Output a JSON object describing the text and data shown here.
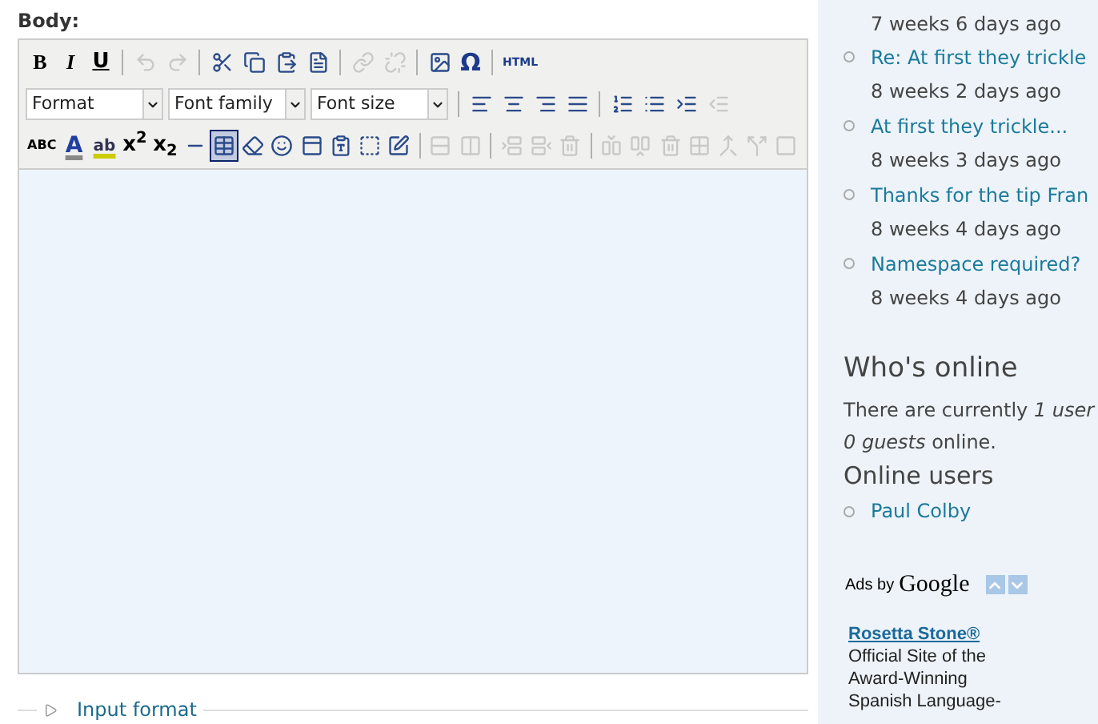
{
  "body_label": "Body:",
  "toolbar": [
    [
      {
        "kind": "text",
        "label": "B",
        "disabled": false
      },
      {
        "kind": "text",
        "label": "I",
        "disabled": false
      },
      {
        "kind": "text",
        "label": "U",
        "disabled": false
      },
      {
        "kind": "sep"
      },
      {
        "kind": "icon",
        "disabled": true
      },
      {
        "kind": "icon",
        "disabled": true
      },
      {
        "kind": "sep"
      },
      {
        "kind": "icon",
        "disabled": false
      },
      {
        "kind": "icon",
        "disabled": false
      },
      {
        "kind": "icon",
        "disabled": false
      },
      {
        "kind": "icon",
        "disabled": false
      },
      {
        "kind": "sep"
      },
      {
        "kind": "icon",
        "disabled": true
      },
      {
        "kind": "icon",
        "disabled": true
      },
      {
        "kind": "sep"
      },
      {
        "kind": "icon",
        "disabled": false
      },
      {
        "kind": "text",
        "label": "Ω",
        "disabled": false
      },
      {
        "kind": "sep"
      },
      {
        "kind": "text",
        "label": "HTML",
        "disabled": false
      }
    ],
    [
      {
        "kind": "select",
        "label": "Format"
      },
      {
        "kind": "select",
        "label": "Font family"
      },
      {
        "kind": "select",
        "label": "Font size"
      },
      {
        "kind": "sep"
      },
      {
        "kind": "icon",
        "disabled": false
      },
      {
        "kind": "icon",
        "disabled": false
      },
      {
        "kind": "icon",
        "disabled": false
      },
      {
        "kind": "icon",
        "disabled": false
      },
      {
        "kind": "sep"
      },
      {
        "kind": "icon",
        "disabled": false
      },
      {
        "kind": "icon",
        "disabled": false
      },
      {
        "kind": "icon",
        "disabled": false
      },
      {
        "kind": "icon",
        "disabled": true
      }
    ],
    [
      {
        "kind": "text",
        "label": "ABC",
        "disabled": false
      },
      {
        "kind": "text",
        "label": "A",
        "disabled": false
      },
      {
        "kind": "text",
        "label": "ab",
        "disabled": false
      },
      {
        "kind": "text",
        "label": "x$^{2}$",
        "disabled": false
      },
      {
        "kind": "text",
        "label": "x$_{2}$",
        "disabled": false
      },
      {
        "kind": "icon",
        "disabled": false
      },
      {
        "kind": "icon",
        "disabled": false,
        "selected": true
      },
      {
        "kind": "icon",
        "disabled": false
      },
      {
        "kind": "icon",
        "disabled": false
      },
      {
        "kind": "icon",
        "disabled": false
      },
      {
        "kind": "icon",
        "disabled": false
      },
      {
        "kind": "icon",
        "disabled": false
      },
      {
        "kind": "icon",
        "disabled": false
      },
      {
        "kind": "sep"
      },
      {
        "kind": "icon",
        "disabled": true
      },
      {
        "kind": "icon",
        "disabled": true
      },
      {
        "kind": "sep"
      },
      {
        "kind": "icon",
        "disabled": true
      },
      {
        "kind": "icon",
        "disabled": true
      },
      {
        "kind": "icon",
        "disabled": true
      },
      {
        "kind": "sep"
      },
      {
        "kind": "icon",
        "disabled": true
      },
      {
        "kind": "icon",
        "disabled": true
      },
      {
        "kind": "icon",
        "disabled": true
      },
      {
        "kind": "icon",
        "disabled": true
      },
      {
        "kind": "icon",
        "disabled": true
      },
      {
        "kind": "icon",
        "disabled": true
      },
      {
        "kind": "icon",
        "disabled": true
      }
    ]
  ],
  "input_format": {
    "label": "Input format",
    "expanded": false
  },
  "sidebar": {
    "first_time": "7 weeks 6 days ago",
    "posts": [
      {
        "title": "Re: At first they trickle",
        "time": "8 weeks 2 days ago"
      },
      {
        "title": "At first they trickle...",
        "time": "8 weeks 3 days ago"
      },
      {
        "title": "Thanks for the tip Fran",
        "time": "8 weeks 4 days ago"
      },
      {
        "title": "Namespace required?",
        "time": "8 weeks 4 days ago"
      }
    ],
    "whos_online": {
      "title": "Who's online",
      "lines": [
        "There are currently *1 user*",
        "*0 guests* online."
      ],
      "users_title": "Online users",
      "users": [
        "Paul Colby"
      ]
    },
    "ads": {
      "ads_by": "Ads by",
      "google": "Google",
      "ad_title": "Rosetta Stone®",
      "ad_text": "Official Site of the Award-Winning Spanish Language-"
    }
  }
}
